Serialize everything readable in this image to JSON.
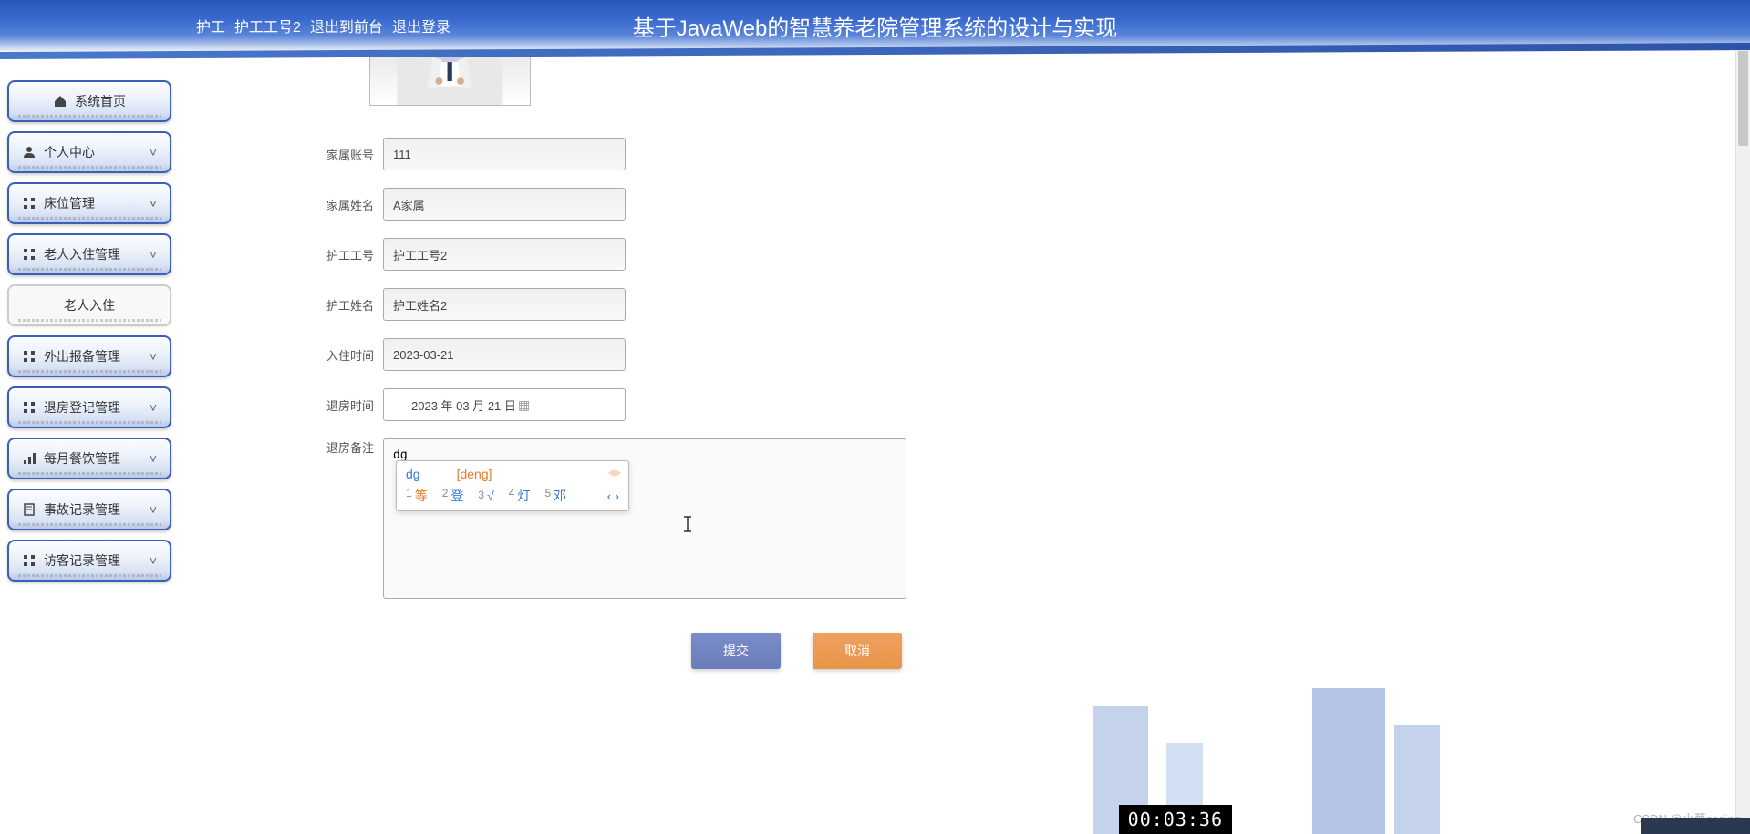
{
  "header": {
    "user_role": "护工",
    "user_id": "护工工号2",
    "logout_front": "退出到前台",
    "logout": "退出登录",
    "title": "基于JavaWeb的智慧养老院管理系统的设计与实现"
  },
  "sidebar": {
    "items": [
      {
        "name": "home",
        "label": "系统首页",
        "icon": "home"
      },
      {
        "name": "profile",
        "label": "个人中心",
        "icon": "person",
        "expand": true
      },
      {
        "name": "bed",
        "label": "床位管理",
        "icon": "grid",
        "expand": true
      },
      {
        "name": "checkin",
        "label": "老人入住管理",
        "icon": "grid",
        "expand": true
      },
      {
        "name": "checkin-sub",
        "label": "老人入住",
        "sub": true
      },
      {
        "name": "outing",
        "label": "外出报备管理",
        "icon": "grid",
        "expand": true
      },
      {
        "name": "checkout",
        "label": "退房登记管理",
        "icon": "grid",
        "expand": true
      },
      {
        "name": "meal",
        "label": "每月餐饮管理",
        "icon": "bars",
        "expand": true
      },
      {
        "name": "accident",
        "label": "事故记录管理",
        "icon": "doc",
        "expand": true
      },
      {
        "name": "visitor",
        "label": "访客记录管理",
        "icon": "grid",
        "expand": true
      }
    ]
  },
  "form": {
    "family_account_label": "家属账号",
    "family_account_value": "111",
    "family_name_label": "家属姓名",
    "family_name_value": "A家属",
    "nurse_id_label": "护工工号",
    "nurse_id_value": "护工工号2",
    "nurse_name_label": "护工姓名",
    "nurse_name_value": "护工姓名2",
    "checkin_time_label": "入住时间",
    "checkin_time_value": "2023-03-21",
    "checkout_time_label": "退房时间",
    "checkout_time_value": "2023 年 03 月 21 日",
    "checkout_note_label": "退房备注",
    "checkout_note_value": "dg"
  },
  "ime": {
    "input": "dg",
    "pinyin": "[deng]",
    "candidates": [
      {
        "num": "1",
        "word": "等"
      },
      {
        "num": "2",
        "word": "登"
      },
      {
        "num": "3",
        "word": "√"
      },
      {
        "num": "4",
        "word": "灯"
      },
      {
        "num": "5",
        "word": "邓"
      }
    ],
    "prev": "‹",
    "next": "›"
  },
  "buttons": {
    "submit": "提交",
    "cancel": "取消"
  },
  "timer": "00:03:36",
  "watermark": "CSDN @小蔡coding"
}
